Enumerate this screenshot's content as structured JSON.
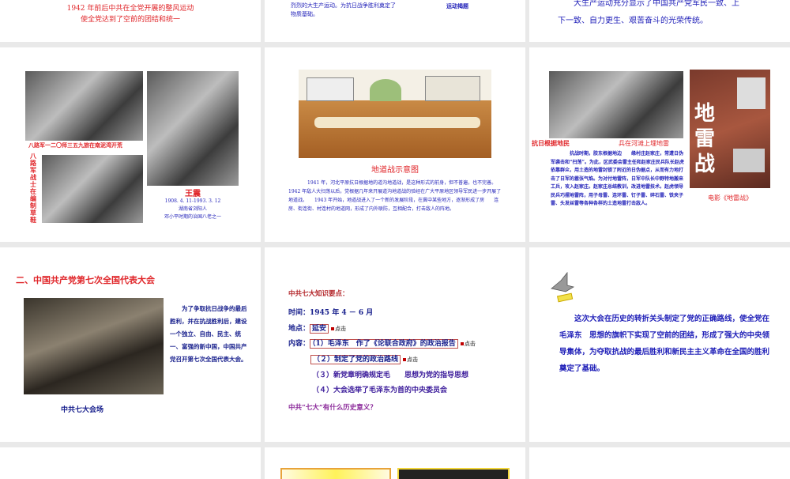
{
  "row0": {
    "s1": {
      "lines": [
        "1942 年前后中共在全党开展的整风运动",
        "使全党达到了空前的团结和统一"
      ]
    },
    "s2": {
      "lines": [
        "烈烈的大生产运动。为抗日战争胜利奠定了",
        "物质基础。"
      ],
      "side": "运动揭题"
    },
    "s3": {
      "lines": [
        "大生产运动充分显示了中国共产党军民一致、上",
        "下一致、自力更生、艰苦奋斗的光荣传统。"
      ]
    }
  },
  "row1": {
    "s1": {
      "caption_top": "八路军一二〇师三五九旅在南泥湾开荒",
      "caption_vertical": "八路军战士在编制草鞋",
      "name": "王震",
      "dates": "1908. 4. 11-1993. 3. 12",
      "origin": "湖南省浏阳人",
      "note": "邓小平时期的治国八老之一"
    },
    "s2": {
      "title": "地道战示意图",
      "text": "1941 年，河北平原抗日根据地的道沟地道战，是这种形式的前身，但不普遍，也不完善。1942 年敌人大扫荡以后，党根据几年来开展道沟地道战的验经在广大平原地区领导军民进一步开展了地道战。　　1943 年开始，地道战进入了一个新的发展阶段，在冀中某些地方，逐渐形成了房　　连房、街连街、村连村的地道网，形成了内外联防，互相配合，打击敌人的阵地。"
    },
    "s3": {
      "caption_left": "抗日根据地民",
      "caption_right": "兵在河滩上埋地雷",
      "text": "抗战时期，胶东根据地边　　缘村庄赵家庄，常遭日伪军袭击和“扫荡”。为此，区武委会雷主任和赵家庄民兵队长赵虎依靠群众，用土造的地雷封锁了附近的日伪据点，从而有力地打击了日军的嚣张气焰。为对付地雷阵，日军中队长中野特地搬来工兵，攻入赵家庄。赵家庄总结教训，改进地雷技术。赵虎领导民兵巧摆地雷阵，用子母雷、连环雷、钉子雷、碎石雷、铁夹子雷、头发丝雷等各种各样的土造地雷打击敌人。",
      "poster_title": "地雷战",
      "poster_caption": "电影《地雷战》"
    }
  },
  "row2": {
    "s1": {
      "title": "二、中国共产党第七次全国代表大会",
      "text": "为了争取抗日战争的最后胜利，并在抗战胜利后，建设一个独立、自由、民主、统一、富强的新中国，中国共产党召开第七次全国代表大会。",
      "caption": "中共七大会场"
    },
    "s2": {
      "heading": "中共七大知识要点：",
      "time_label": "时间：",
      "time_value": "1945 年 4 － 6 月",
      "place_label": "地点：",
      "place_value": "延安",
      "content_label": "内容：",
      "item1": "（1）毛泽东　作了《论联合政府》的政治报告",
      "item2": "（２）制定了党的政治路线",
      "item3": "（３）新党章明确规定毛　　思想为党的指导思想",
      "item4": "（４）大会选举了毛泽东为首的中央委员会",
      "click": "点击",
      "question": "中共“七大”有什么历史意义？"
    },
    "s3": {
      "text": "这次大会在历史的转折关头制定了党的正确路线，使全党在毛泽东　思想的旗帜下实现了空前的团结，形成了强大的中央领导集体，为夺取抗战的最后胜利和新民主主义革命在全国的胜利奠定了基础。"
    }
  }
}
